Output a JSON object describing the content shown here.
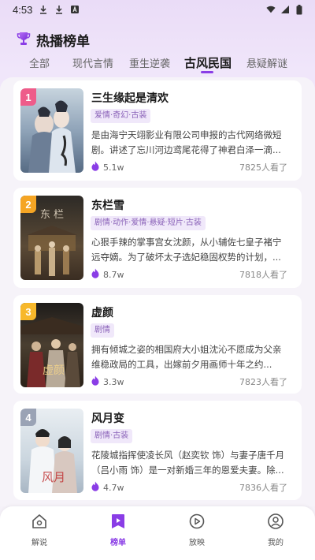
{
  "status_bar": {
    "time": "4:53"
  },
  "header": {
    "title": "热播榜单"
  },
  "tabs": [
    {
      "label": "全部"
    },
    {
      "label": "现代言情"
    },
    {
      "label": "重生逆袭"
    },
    {
      "label": "古风民国"
    },
    {
      "label": "悬疑解谜"
    }
  ],
  "active_tab": "古风民国",
  "colors": {
    "accent": "#8a3de6",
    "rank1": "#ee5c8a",
    "rank2": "#f5a524",
    "rank3": "#f7b82b",
    "rank4": "#9aa3b5"
  },
  "dramas": [
    {
      "rank": "1",
      "title": "三生缘起是清欢",
      "tags": "爱情·奇幻·古装",
      "desc": "是由海宁天翊影业有限公司申报的古代网络微短剧。讲述了忘川河边鸢尾花得了神君白泽一滴...",
      "hot": "5.1w",
      "views": "7825人看了"
    },
    {
      "rank": "2",
      "title": "东栏雪",
      "tags": "剧情·动作·爱情·悬疑·短片·古装",
      "desc": "心狠手辣的掌事宫女沈颜，从小辅佐七皇子褚宁远夺嫡。为了破坏太子选妃稳固权势的计划，...",
      "hot": "8.7w",
      "views": "7818人看了"
    },
    {
      "rank": "3",
      "title": "虚颜",
      "tags": "剧情",
      "desc": "拥有倾城之姿的相国府大小姐沈沁不愿成为父亲维稳政局的工具，出嫁前夕用画师十年之约...",
      "hot": "3.3w",
      "views": "7823人看了"
    },
    {
      "rank": "4",
      "title": "风月变",
      "tags": "剧情·古装",
      "desc": "花陵城指挥使凌长风（赵奕钦 饰）与妻子唐千月（吕小雨 饰）是一对新婚三年的恩爱夫妻。除...",
      "hot": "4.7w",
      "views": "7836人看了"
    }
  ],
  "bottom_nav": [
    {
      "label": "解说",
      "icon": "home-icon"
    },
    {
      "label": "榜单",
      "icon": "ranking-icon"
    },
    {
      "label": "放映",
      "icon": "play-icon"
    },
    {
      "label": "我的",
      "icon": "profile-icon"
    }
  ]
}
